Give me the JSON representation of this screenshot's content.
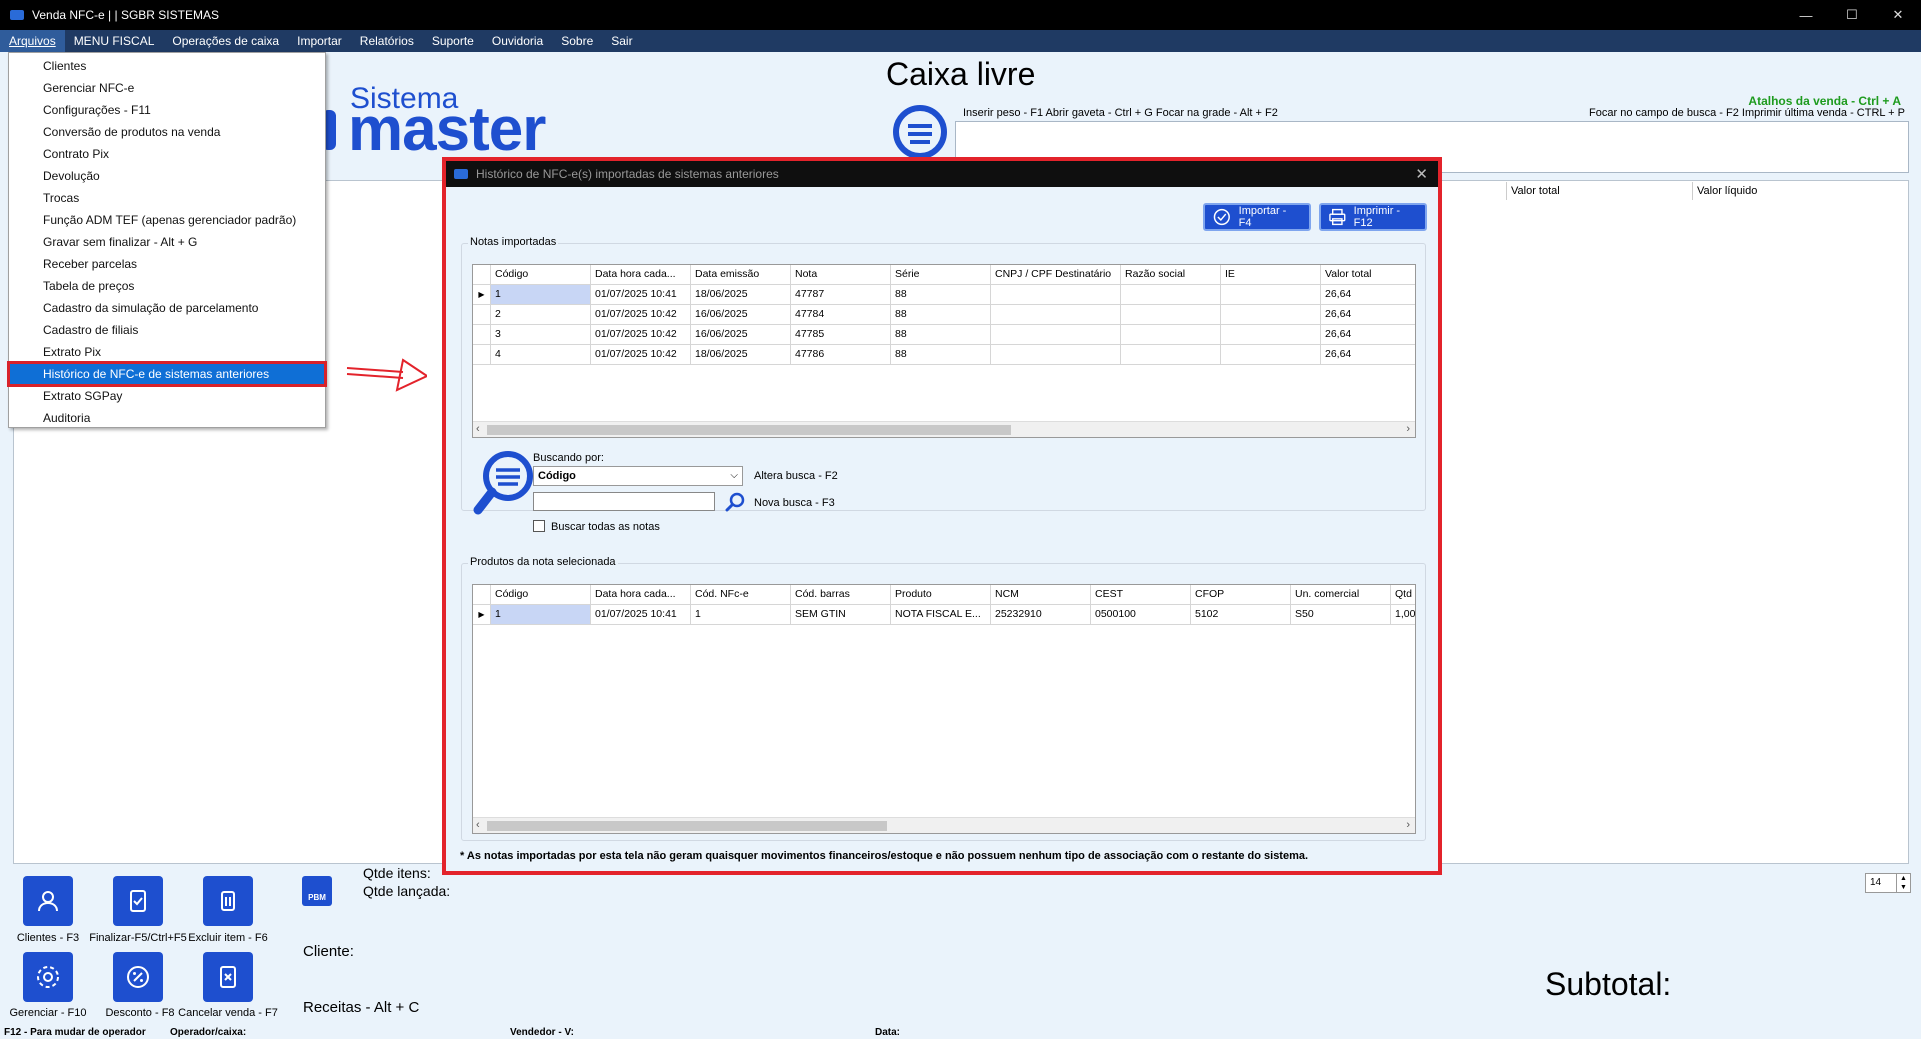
{
  "window": {
    "title": "Venda NFC-e | | SGBR SISTEMAS",
    "minimize": "—",
    "maximize": "☐",
    "close": "✕"
  },
  "menubar": [
    "Arquivos",
    "MENU FISCAL",
    "Operações de caixa",
    "Importar",
    "Relatórios",
    "Suporte",
    "Ouvidoria",
    "Sobre",
    "Sair"
  ],
  "background": {
    "caixa": "Caixa livre",
    "logo_sistema": "Sistema",
    "logo_master": "master",
    "atalhos_title": "Atalhos da venda - Ctrl + A",
    "shortcuts_left": "Inserir peso - F1    Abrir gaveta - Ctrl + G    Focar na grade - Alt + F2",
    "shortcuts_right": "Focar no campo de busca - F2   Imprimir última venda - CTRL + P",
    "grid_headers": [
      "Valor total",
      "Valor líquido"
    ]
  },
  "arquivos_menu": [
    "Clientes",
    "Gerenciar NFC-e",
    "Configurações - F11",
    "Conversão de produtos na venda",
    "Contrato Pix",
    "Devolução",
    "Trocas",
    "Função ADM TEF (apenas gerenciador padrão)",
    "Gravar sem finalizar - Alt + G",
    "Receber parcelas",
    "Tabela de preços",
    "Cadastro da simulação de parcelamento",
    "Cadastro de filiais",
    "Extrato Pix",
    "Histórico de NFC-e de sistemas anteriores",
    "Extrato SGPay",
    "Auditoria"
  ],
  "arquivos_selected_index": 14,
  "dialog": {
    "title": "Histórico de NFC-e(s) importadas de sistemas anteriores",
    "close": "✕",
    "btn_importar": "Importar - F4",
    "btn_imprimir": "Imprimir - F12",
    "notas_title": "Notas importadas",
    "notas_columns": [
      "Código",
      "Data hora cada...",
      "Data emissão",
      "Nota",
      "Série",
      "CNPJ / CPF Destinatário",
      "Razão social",
      "IE",
      "Valor total"
    ],
    "notas_rows": [
      [
        "1",
        "01/07/2025 10:41",
        "18/06/2025",
        "47787",
        "88",
        "",
        "",
        "",
        "26,64"
      ],
      [
        "2",
        "01/07/2025 10:42",
        "16/06/2025",
        "47784",
        "88",
        "",
        "",
        "",
        "26,64"
      ],
      [
        "3",
        "01/07/2025 10:42",
        "16/06/2025",
        "47785",
        "88",
        "",
        "",
        "",
        "26,64"
      ],
      [
        "4",
        "01/07/2025 10:42",
        "18/06/2025",
        "47786",
        "88",
        "",
        "",
        "",
        "26,64"
      ]
    ],
    "buscando_label": "Buscando por:",
    "buscando_value": "Código",
    "altera_busca": "Altera busca - F2",
    "nova_busca": "Nova busca - F3",
    "search_value": "",
    "buscar_todas": "Buscar todas as notas",
    "produtos_title": "Produtos da nota selecionada",
    "produtos_columns": [
      "Código",
      "Data hora cada...",
      "Cód. NFc-e",
      "Cód. barras",
      "Produto",
      "NCM",
      "CEST",
      "CFOP",
      "Un. comercial",
      "Qtd"
    ],
    "produtos_rows": [
      [
        "1",
        "01/07/2025 10:41",
        "1",
        "SEM GTIN",
        "NOTA FISCAL E...",
        "25232910",
        "0500100",
        "5102",
        "S50",
        "1,00"
      ]
    ],
    "footnote": "* As notas importadas por esta tela não geram quaisquer movimentos financeiros/estoque e não possuem nenhum tipo de associação com o restante do sistema."
  },
  "bottom": {
    "buttons": [
      {
        "label": "Clientes - F3",
        "icon": "user-icon"
      },
      {
        "label": "Finalizar-F5/Ctrl+F5",
        "icon": "document-check-icon"
      },
      {
        "label": "Excluir item - F6",
        "icon": "trash-icon"
      },
      {
        "label": "Gerenciar - F10",
        "icon": "gear-icon"
      },
      {
        "label": "Desconto - F8",
        "icon": "percent-icon"
      },
      {
        "label": "Cancelar venda - F7",
        "icon": "document-x-icon"
      }
    ],
    "pbm": "PBM",
    "qtde_itens": "Qtde itens:",
    "qtde_lancada": "Qtde lançada:",
    "cliente": "Cliente:",
    "receitas": "Receitas - Alt + C",
    "subtotal": "Subtotal:",
    "spinner_value": "14",
    "status": {
      "f12": "F12 - Para mudar de operador",
      "operador": "Operador/caixa:",
      "vendedor": "Vendedor - V:",
      "data": "Data:"
    }
  },
  "colors": {
    "accent": "#1e4fcf",
    "highlight_border": "#e3232b",
    "menubar": "#1f3a63",
    "selection": "#0f6fd6"
  }
}
